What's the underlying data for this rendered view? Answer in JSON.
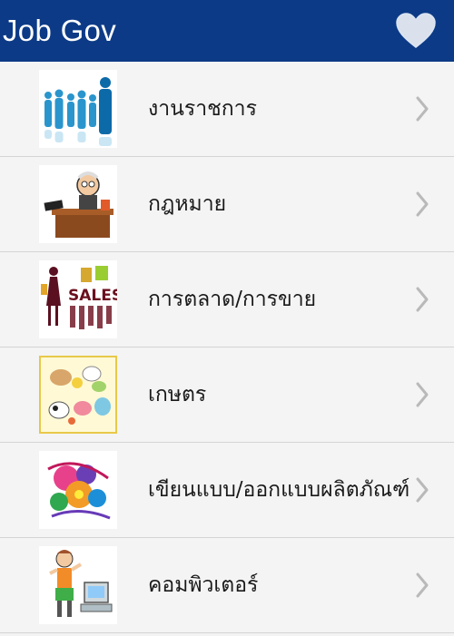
{
  "app": {
    "title": "Job Gov",
    "favorite_icon": "heart-icon",
    "bar_color": "#0c3a86"
  },
  "categories": [
    {
      "label": "งานราชการ",
      "icon": "people-silhouettes-icon"
    },
    {
      "label": "กฎหมาย",
      "icon": "lawyer-desk-icon"
    },
    {
      "label": "การตลาด/การขาย",
      "icon": "sales-shopping-icon"
    },
    {
      "label": "เกษตร",
      "icon": "farm-animals-icon"
    },
    {
      "label": "เขียนแบบ/ออกแบบผลิตภัณฑ์",
      "icon": "design-art-icon"
    },
    {
      "label": "คอมพิวเตอร์",
      "icon": "computer-user-icon"
    }
  ]
}
